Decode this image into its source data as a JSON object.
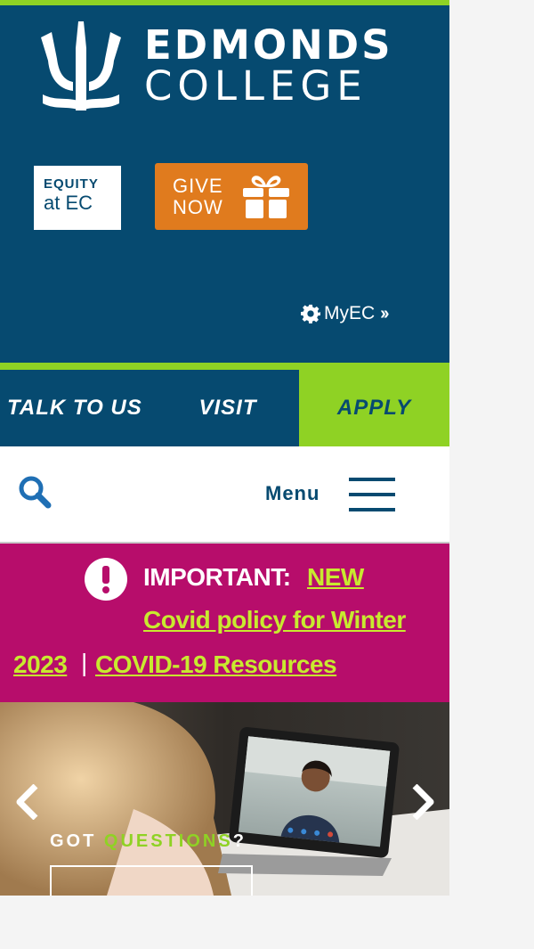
{
  "colors": {
    "navy": "#064a70",
    "lime": "#8fd224",
    "orange": "#e07b1e",
    "magenta": "#b70d6b",
    "link_yellow_green": "#c8ea2f"
  },
  "header": {
    "logo": {
      "line1": "EDMONDS",
      "line2": "COLLEGE",
      "icon": "trident-icon"
    },
    "equity_button": {
      "line1": "EQUITY",
      "line2": "at EC"
    },
    "give_button": {
      "line1": "GIVE",
      "line2": "NOW",
      "icon": "gift-icon"
    },
    "myec_link": {
      "label": "MyEC",
      "icon": "gear-icon",
      "trailing_icon": "double-chevron-right-icon"
    }
  },
  "cta_bar": {
    "talk": "TALK TO US",
    "visit": "VISIT",
    "apply": "APPLY"
  },
  "nav": {
    "search_icon": "search-icon",
    "menu_label": "Menu",
    "menu_icon": "hamburger-icon"
  },
  "alert": {
    "icon": "exclamation-icon",
    "label": "IMPORTANT:",
    "link1_part1": "NEW",
    "link1_part2": "Covid policy for Winter",
    "link1_part3": "2023",
    "separator": "|",
    "link2": "COVID-19 Resources"
  },
  "hero": {
    "caption_part1": "GOT ",
    "caption_accent": "QUESTIONS",
    "caption_part2": "?",
    "prev_icon": "chevron-left-icon",
    "next_icon": "chevron-right-icon"
  }
}
